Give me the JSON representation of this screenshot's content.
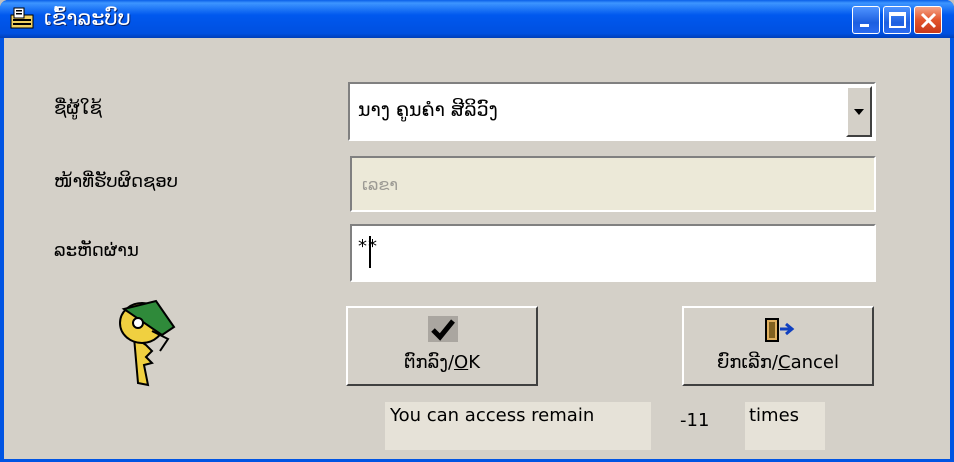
{
  "window": {
    "title": "ເຂົ້າລະບົບ",
    "accent": "#0054e3",
    "icons": [
      "app-icon",
      "minimize-icon",
      "maximize-icon",
      "close-icon"
    ]
  },
  "form": {
    "user_label": "ຊື່ຜູ້ໃຊ້",
    "user_value": "ນາງ ຄູນຄຳ ສີລິວົງ",
    "role_label": "ໜ້າທີ່ຮັບຜິດຊອບ",
    "role_value": "ເລຂາ",
    "password_label": "ລະຫັດຜ່ານ",
    "password_value": "**"
  },
  "buttons": {
    "ok_prefix": "ຕົກລົງ/",
    "ok_mnemonic": "O",
    "ok_rest": "K",
    "cancel_prefix": "ຍົກເລີກ/",
    "cancel_mnemonic": "C",
    "cancel_rest": "ancel"
  },
  "status": {
    "text": "You can access remain",
    "count": "-11",
    "unit": "times"
  }
}
